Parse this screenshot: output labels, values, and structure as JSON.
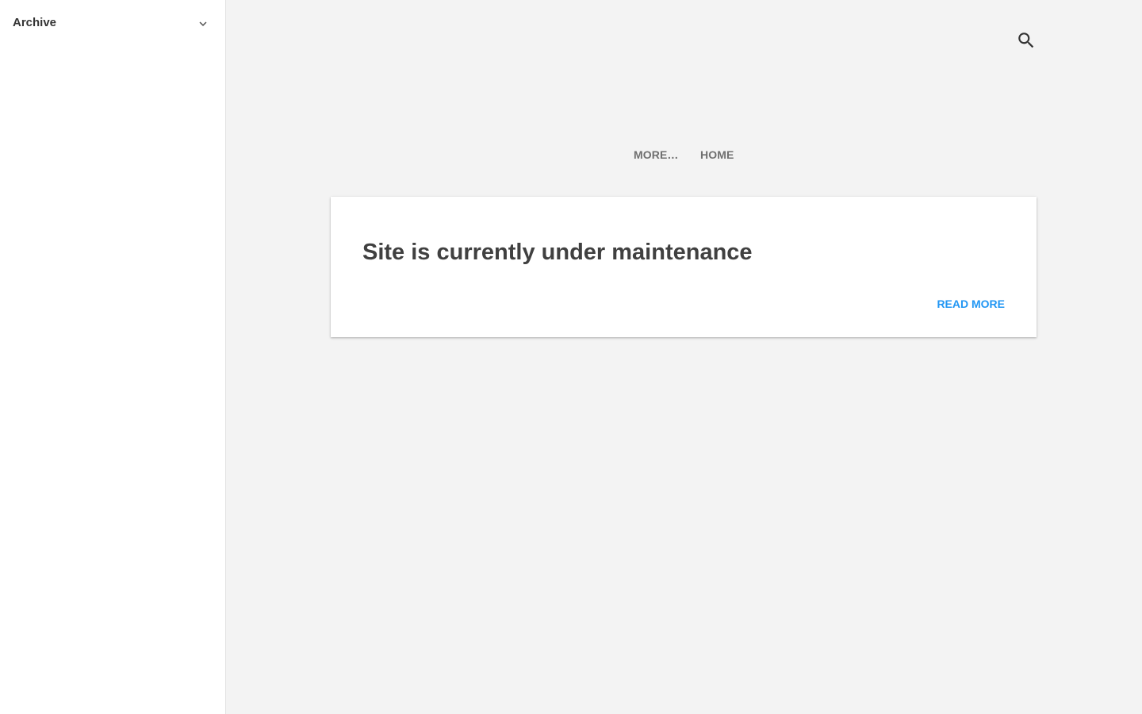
{
  "sidebar": {
    "archive_label": "Archive",
    "toggle_icon": "chevron-down-icon"
  },
  "header": {
    "search_icon": "search-icon"
  },
  "nav": {
    "items": [
      {
        "label": "MORE…"
      },
      {
        "label": "HOME"
      }
    ]
  },
  "post": {
    "title": "Site is currently under maintenance",
    "read_more_label": "READ MORE"
  },
  "colors": {
    "page_background": "#f3f3f3",
    "card_background": "#ffffff",
    "link_accent": "#2196f3",
    "title_text": "#404040",
    "nav_text": "#6f6f6f"
  }
}
